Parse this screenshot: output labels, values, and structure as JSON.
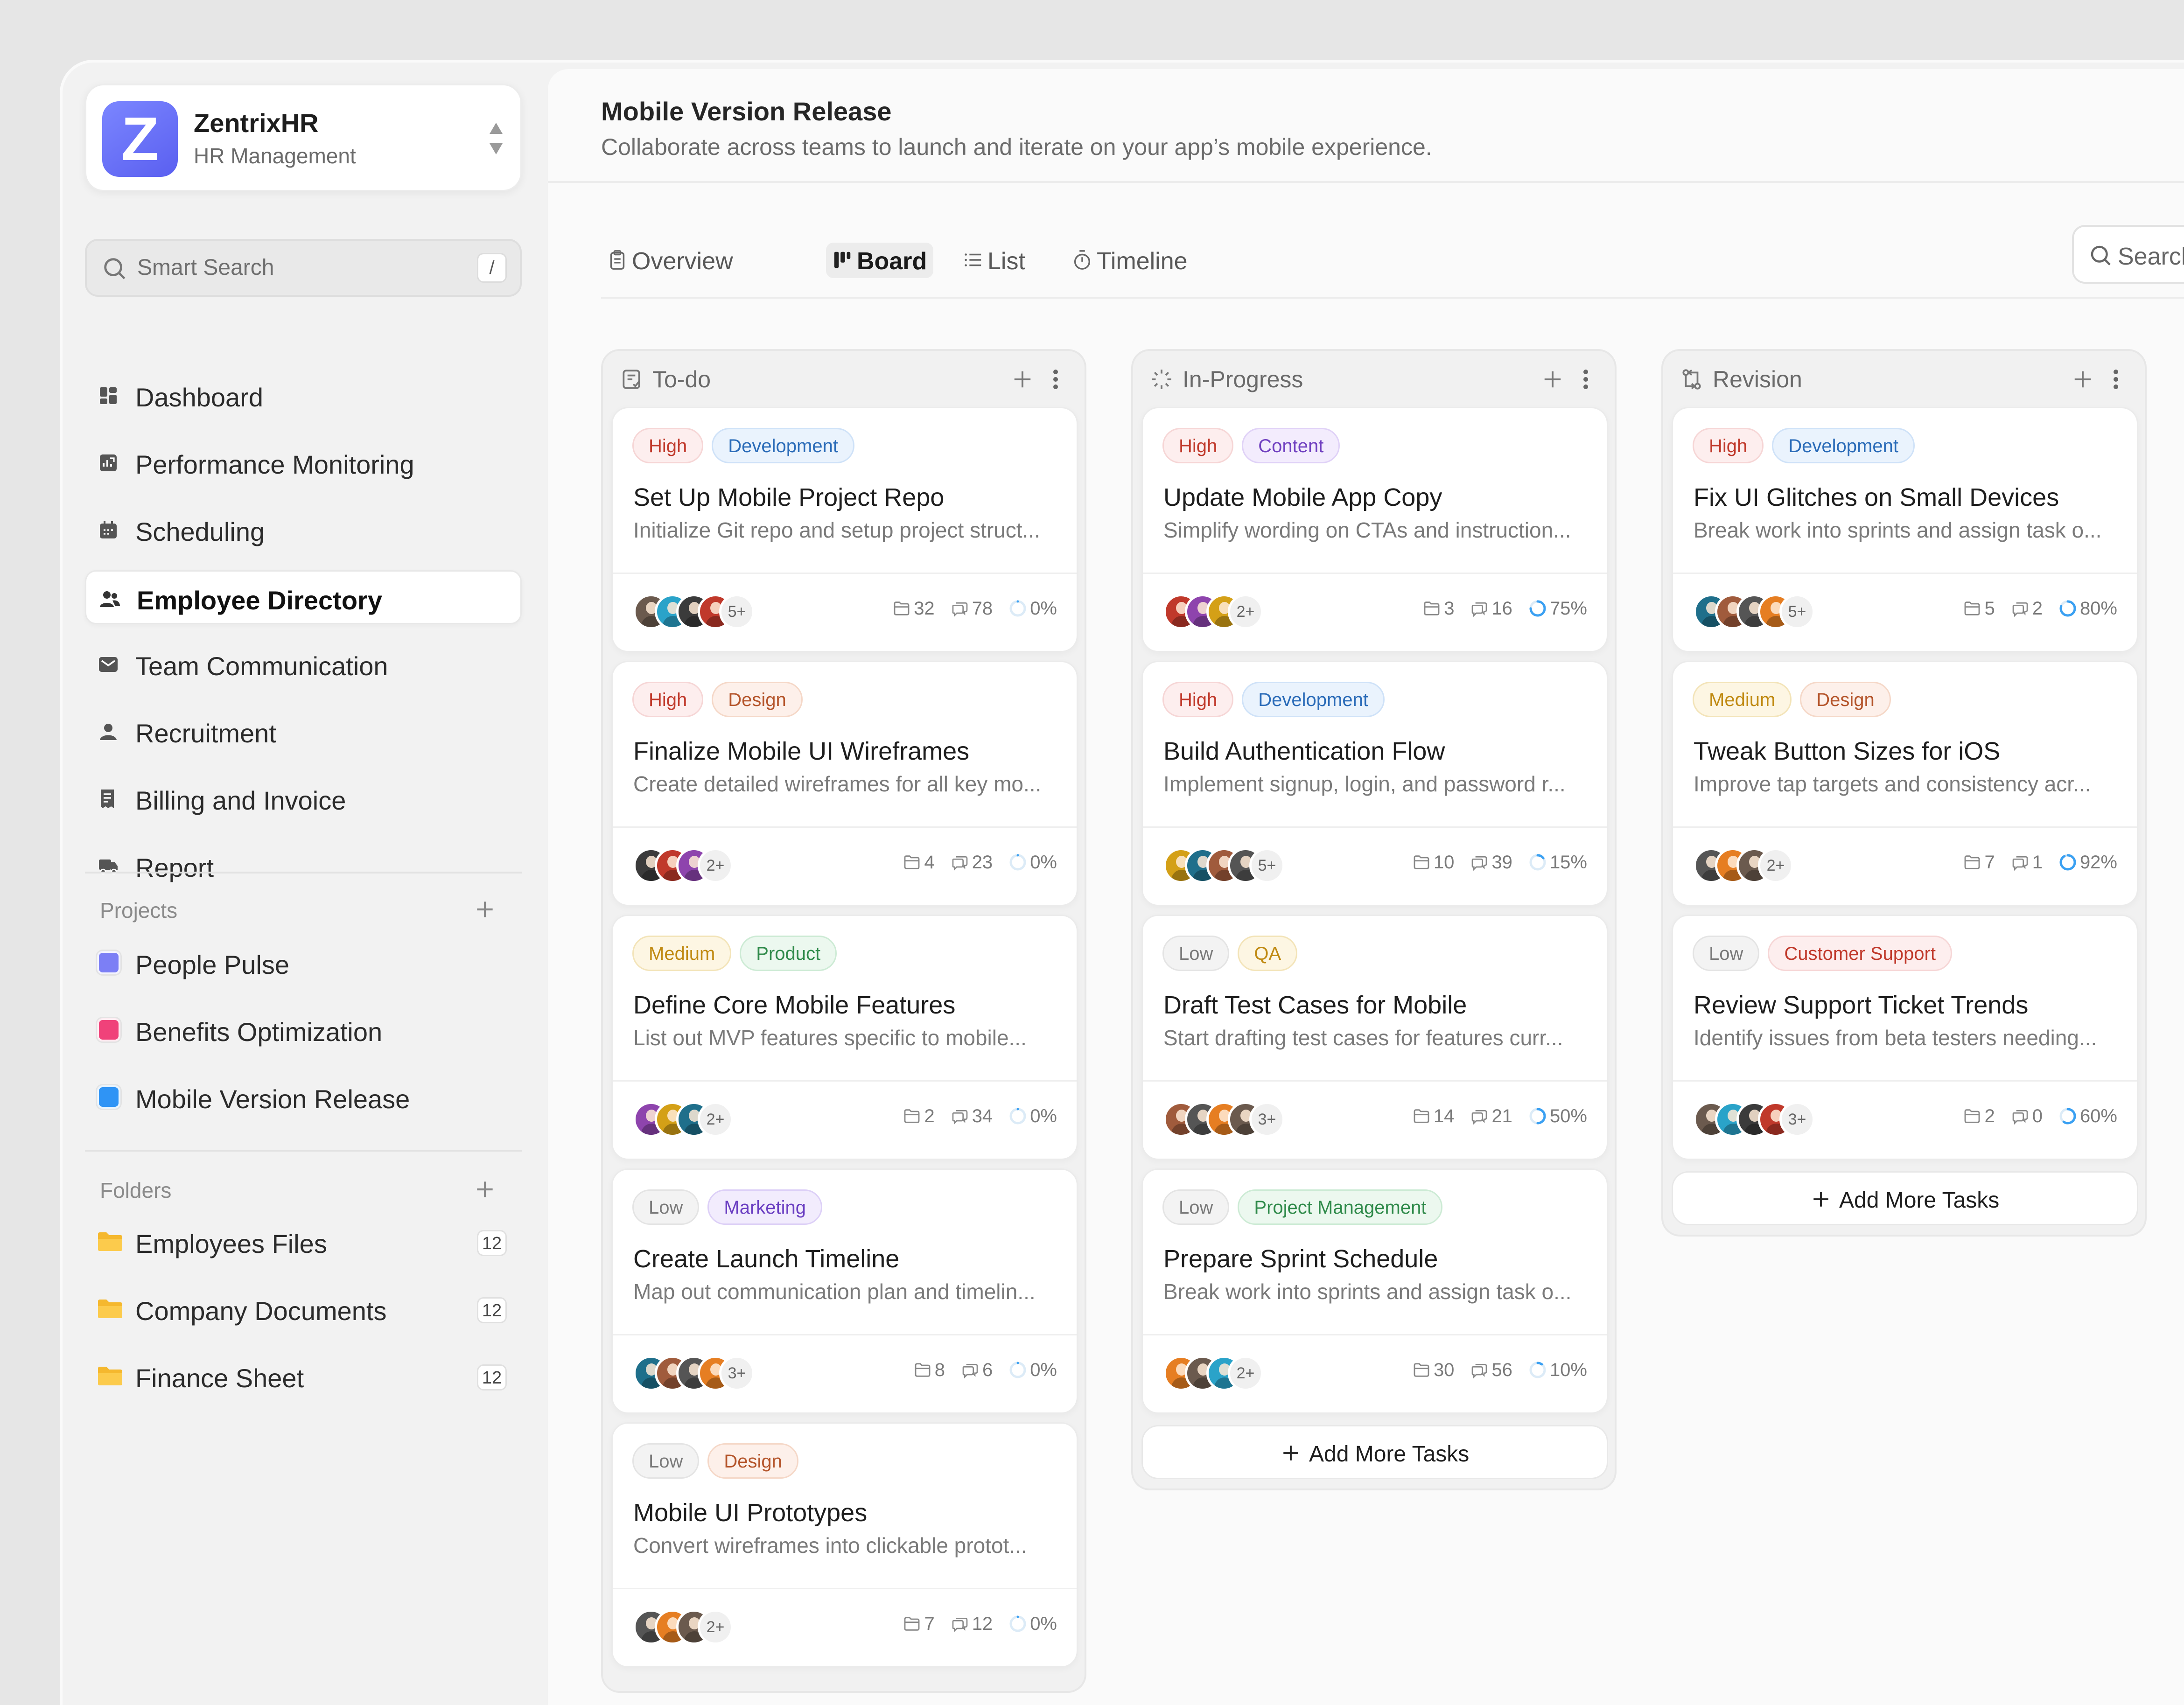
{
  "brand": {
    "name": "ZentrixHR",
    "subtitle": "HR Management",
    "logo_letter": "Z",
    "logo_color": "#6a70f6"
  },
  "sidebar": {
    "search_placeholder": "Smart Search",
    "search_shortcut": "/",
    "nav": [
      {
        "label": "Dashboard",
        "icon": "grid-icon"
      },
      {
        "label": "Performance Monitoring",
        "icon": "chart-icon"
      },
      {
        "label": "Scheduling",
        "icon": "calendar-icon"
      },
      {
        "label": "Employee Directory",
        "icon": "users-icon",
        "active": true
      },
      {
        "label": "Team Communication",
        "icon": "mail-icon"
      },
      {
        "label": "Recruitment",
        "icon": "user-icon"
      },
      {
        "label": "Billing and Invoice",
        "icon": "receipt-icon"
      },
      {
        "label": "Report",
        "icon": "truck-icon"
      }
    ],
    "projects_title": "Projects",
    "projects": [
      {
        "label": "People Pulse",
        "color": "#7c7ff5"
      },
      {
        "label": "Benefits Optimization",
        "color": "#f0427a"
      },
      {
        "label": "Mobile Version Release",
        "color": "#2f94f5"
      }
    ],
    "folders_title": "Folders",
    "folders": [
      {
        "label": "Employees Files",
        "count": "12"
      },
      {
        "label": "Company Documents",
        "count": "12"
      },
      {
        "label": "Finance Sheet",
        "count": "12"
      }
    ]
  },
  "header": {
    "title": "Mobile Version Release",
    "subtitle": "Collaborate across teams to launch and iterate on your app’s mobile experience."
  },
  "tabs": [
    {
      "label": "Overview",
      "icon": "clipboard-icon"
    },
    {
      "label": "Board",
      "icon": "board-icon",
      "active": true
    },
    {
      "label": "List",
      "icon": "list-icon"
    },
    {
      "label": "Timeline",
      "icon": "stopwatch-icon"
    }
  ],
  "search_placeholder": "Search",
  "add_more_label": "Add More Tasks",
  "columns": [
    {
      "title": "To-do",
      "icon": "todo-icon",
      "cards": [
        {
          "priority": "High",
          "category": "Development",
          "title": "Set Up Mobile Project Repo",
          "description": "Initialize Git repo and setup project struct...",
          "extra_assignees": "5+",
          "files": "32",
          "comments": "78",
          "progress": "0%"
        },
        {
          "priority": "High",
          "category": "Design",
          "title": "Finalize Mobile UI Wireframes",
          "description": "Create detailed wireframes for all key mo...",
          "extra_assignees": "2+",
          "files": "4",
          "comments": "23",
          "progress": "0%"
        },
        {
          "priority": "Medium",
          "category": "Product",
          "title": "Define Core Mobile Features",
          "description": "List out MVP features specific to mobile...",
          "extra_assignees": "2+",
          "files": "2",
          "comments": "34",
          "progress": "0%"
        },
        {
          "priority": "Low",
          "category": "Marketing",
          "title": "Create Launch Timeline",
          "description": "Map out communication plan and timelin...",
          "extra_assignees": "3+",
          "files": "8",
          "comments": "6",
          "progress": "0%"
        },
        {
          "priority": "Low",
          "category": "Design",
          "title": "Mobile UI Prototypes",
          "description": "Convert wireframes into clickable protot...",
          "extra_assignees": "2+",
          "files": "7",
          "comments": "12",
          "progress": "0%"
        }
      ]
    },
    {
      "title": "In-Progress",
      "icon": "loader-icon",
      "cards": [
        {
          "priority": "High",
          "category": "Content",
          "title": "Update Mobile App Copy",
          "description": "Simplify wording on CTAs and instruction...",
          "extra_assignees": "2+",
          "files": "3",
          "comments": "16",
          "progress": "75%"
        },
        {
          "priority": "High",
          "category": "Development",
          "title": "Build Authentication Flow",
          "description": "Implement signup, login, and password r...",
          "extra_assignees": "5+",
          "files": "10",
          "comments": "39",
          "progress": "15%"
        },
        {
          "priority": "Low",
          "category": "QA",
          "title": "Draft Test Cases for Mobile",
          "description": "Start drafting test cases for features curr...",
          "extra_assignees": "3+",
          "files": "14",
          "comments": "21",
          "progress": "50%"
        },
        {
          "priority": "Low",
          "category": "Project Management",
          "title": "Prepare Sprint Schedule",
          "description": "Break work into sprints and assign task o...",
          "extra_assignees": "2+",
          "files": "30",
          "comments": "56",
          "progress": "10%"
        }
      ]
    },
    {
      "title": "Revision",
      "icon": "revision-icon",
      "cards": [
        {
          "priority": "High",
          "category": "Development",
          "title": "Fix UI Glitches on Small Devices",
          "description": "Break work into sprints and assign task o...",
          "extra_assignees": "5+",
          "files": "5",
          "comments": "2",
          "progress": "80%"
        },
        {
          "priority": "Medium",
          "category": "Design",
          "title": "Tweak Button Sizes for iOS",
          "description": "Improve tap targets and consistency acr...",
          "extra_assignees": "2+",
          "files": "7",
          "comments": "1",
          "progress": "92%"
        },
        {
          "priority": "Low",
          "category": "Customer Support",
          "title": "Review Support Ticket Trends",
          "description": "Identify issues from beta testers needing...",
          "extra_assignees": "3+",
          "files": "2",
          "comments": "0",
          "progress": "60%"
        }
      ]
    }
  ],
  "tag_colors": {
    "High": [
      "#fdeeee",
      "#f6d6d6",
      "#c0392b"
    ],
    "Medium": [
      "#fdf6e3",
      "#f3e4b9",
      "#c08a12"
    ],
    "Low": [
      "#f3f3f3",
      "#e4e4e4",
      "#7a7a7a"
    ],
    "Development": [
      "#eaf3fd",
      "#cfe2f8",
      "#2a6bb8"
    ],
    "Design": [
      "#fdf0ea",
      "#f5d8c8",
      "#b4542a"
    ],
    "Product": [
      "#ecf8ef",
      "#cdebd5",
      "#2f8a4a"
    ],
    "Marketing": [
      "#f2ecfd",
      "#ddd0f7",
      "#6b3fc2"
    ],
    "Content": [
      "#f3ecfd",
      "#e0d2f7",
      "#7040c0"
    ],
    "QA": [
      "#fdf6e3",
      "#f3e4b9",
      "#c08a12"
    ],
    "Project Management": [
      "#ecf8ef",
      "#cdebd5",
      "#2f8a4a"
    ],
    "Customer Support": [
      "#fdeeee",
      "#f6d6d6",
      "#c0392b"
    ]
  }
}
